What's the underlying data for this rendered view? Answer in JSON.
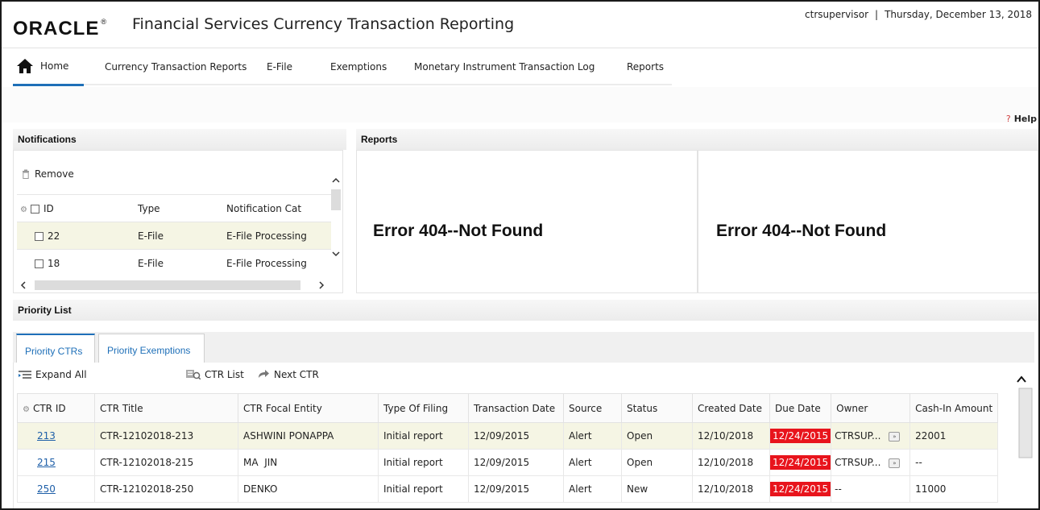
{
  "header": {
    "logo": "ORACLE",
    "logo_mark": "®",
    "title": "Financial Services Currency Transaction Reporting",
    "user": "ctrsupervisor",
    "separator": "|",
    "date": "Thursday, December 13, 2018"
  },
  "nav": {
    "home": "Home",
    "items": [
      "Currency Transaction Reports",
      "E-File",
      "Exemptions",
      "Monetary Instrument Transaction Log",
      "Reports"
    ]
  },
  "help": {
    "label": "Help",
    "mark": "?"
  },
  "notifications": {
    "title": "Notifications",
    "remove": "Remove",
    "columns": [
      "ID",
      "Type",
      "Notification Cat"
    ],
    "rows": [
      {
        "id": "22",
        "type": "E-File",
        "category": "E-File Processing"
      },
      {
        "id": "18",
        "type": "E-File",
        "category": "E-File Processing"
      }
    ]
  },
  "reports": {
    "title": "Reports",
    "error_left": "Error 404--Not Found",
    "error_right": "Error 404--Not Found"
  },
  "priority": {
    "title": "Priority List",
    "tabs": [
      "Priority CTRs",
      "Priority Exemptions"
    ],
    "expand_all": "Expand All",
    "ctr_list": "CTR List",
    "next_ctr": "Next CTR",
    "columns": [
      "CTR ID",
      "CTR Title",
      "CTR Focal Entity",
      "Type Of Filing",
      "Transaction Date",
      "Source",
      "Status",
      "Created Date",
      "Due Date",
      "Owner",
      "Cash-In Amount"
    ],
    "rows": [
      {
        "id": "213",
        "title": "CTR-12102018-213",
        "entity": "ASHWINI PONAPPA",
        "filing": "Initial report",
        "txn_date": "12/09/2015",
        "source": "Alert",
        "status": "Open",
        "created": "12/10/2018",
        "due": "12/24/2015",
        "owner": "CTRSUP...",
        "cash_in": "22001"
      },
      {
        "id": "215",
        "title": "CTR-12102018-215",
        "entity": "MA  JIN",
        "filing": "Initial report",
        "txn_date": "12/09/2015",
        "source": "Alert",
        "status": "Open",
        "created": "12/10/2018",
        "due": "12/24/2015",
        "owner": "CTRSUP...",
        "cash_in": "--"
      },
      {
        "id": "250",
        "title": "CTR-12102018-250",
        "entity": "DENKO",
        "filing": "Initial report",
        "txn_date": "12/09/2015",
        "source": "Alert",
        "status": "New",
        "created": "12/10/2018",
        "due": "12/24/2015",
        "owner": "--",
        "cash_in": "11000"
      }
    ]
  },
  "colors": {
    "accent": "#1e6fb8",
    "due_red": "#e8141c",
    "selected_row": "#f5f5e4"
  }
}
